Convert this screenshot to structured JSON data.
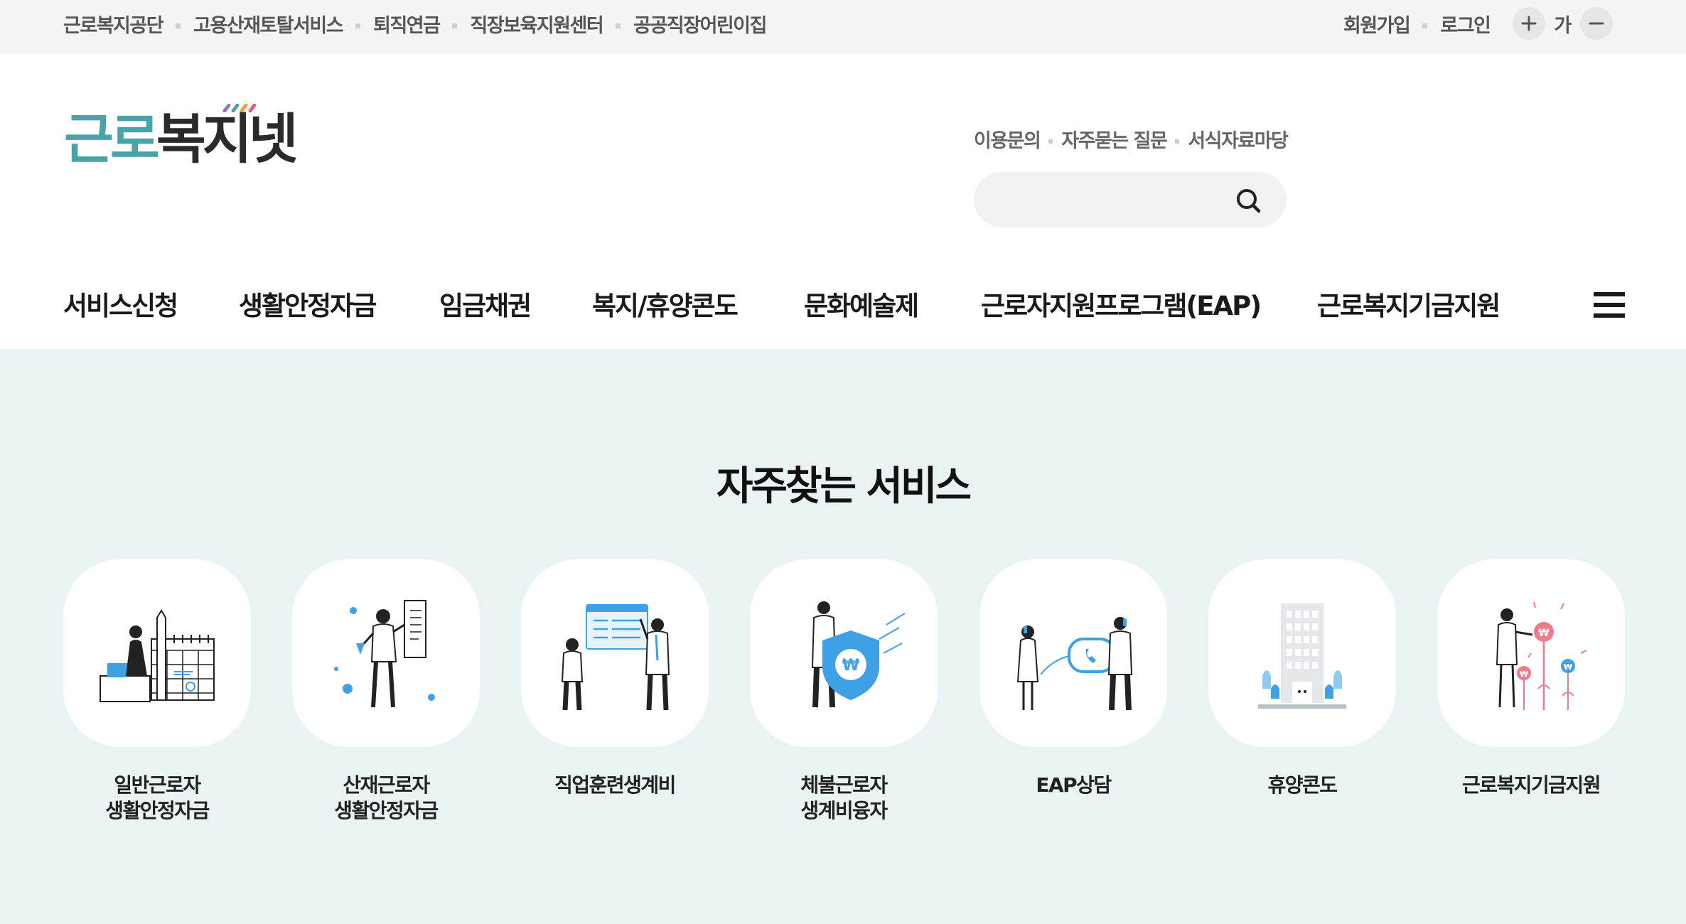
{
  "topbar": {
    "sites": [
      "근로복지공단",
      "고용산재토탈서비스",
      "퇴직연금",
      "직장보육지원센터",
      "공공직장어린이집"
    ],
    "signup": "회원가입",
    "login": "로그인",
    "zoom_label": "가"
  },
  "header": {
    "logo_teal": "근로",
    "logo_dark": "복지넷",
    "util_links": [
      "이용문의",
      "자주묻는 질문",
      "서식자료마당"
    ],
    "search_placeholder": ""
  },
  "gnb": {
    "items": [
      "서비스신청",
      "생활안정자금",
      "임금채권",
      "복지/휴양콘도",
      "문화예술제",
      "근로자지원프로그램(EAP)",
      "근로복지기금지원"
    ]
  },
  "main": {
    "title": "자주찾는 서비스",
    "services": [
      {
        "line1": "일반근로자",
        "line2": "생활안정자금",
        "icon": "calendar-worker-icon"
      },
      {
        "line1": "산재근로자",
        "line2": "생활안정자금",
        "icon": "document-worker-icon"
      },
      {
        "line1": "직업훈련생계비",
        "line2": "",
        "icon": "training-board-icon"
      },
      {
        "line1": "체불근로자",
        "line2": "생계비융자",
        "icon": "won-shield-icon"
      },
      {
        "line1": "EAP상담",
        "line2": "",
        "icon": "phone-counseling-icon"
      },
      {
        "line1": "휴양콘도",
        "line2": "",
        "icon": "condo-building-icon"
      },
      {
        "line1": "근로복지기금지원",
        "line2": "",
        "icon": "fund-flower-icon"
      }
    ]
  },
  "colors": {
    "accent_teal": "#4aa3a7",
    "section_bg": "#e9f3f3",
    "icon_blue": "#3ea1e6",
    "icon_pink": "#ee7a8a"
  }
}
